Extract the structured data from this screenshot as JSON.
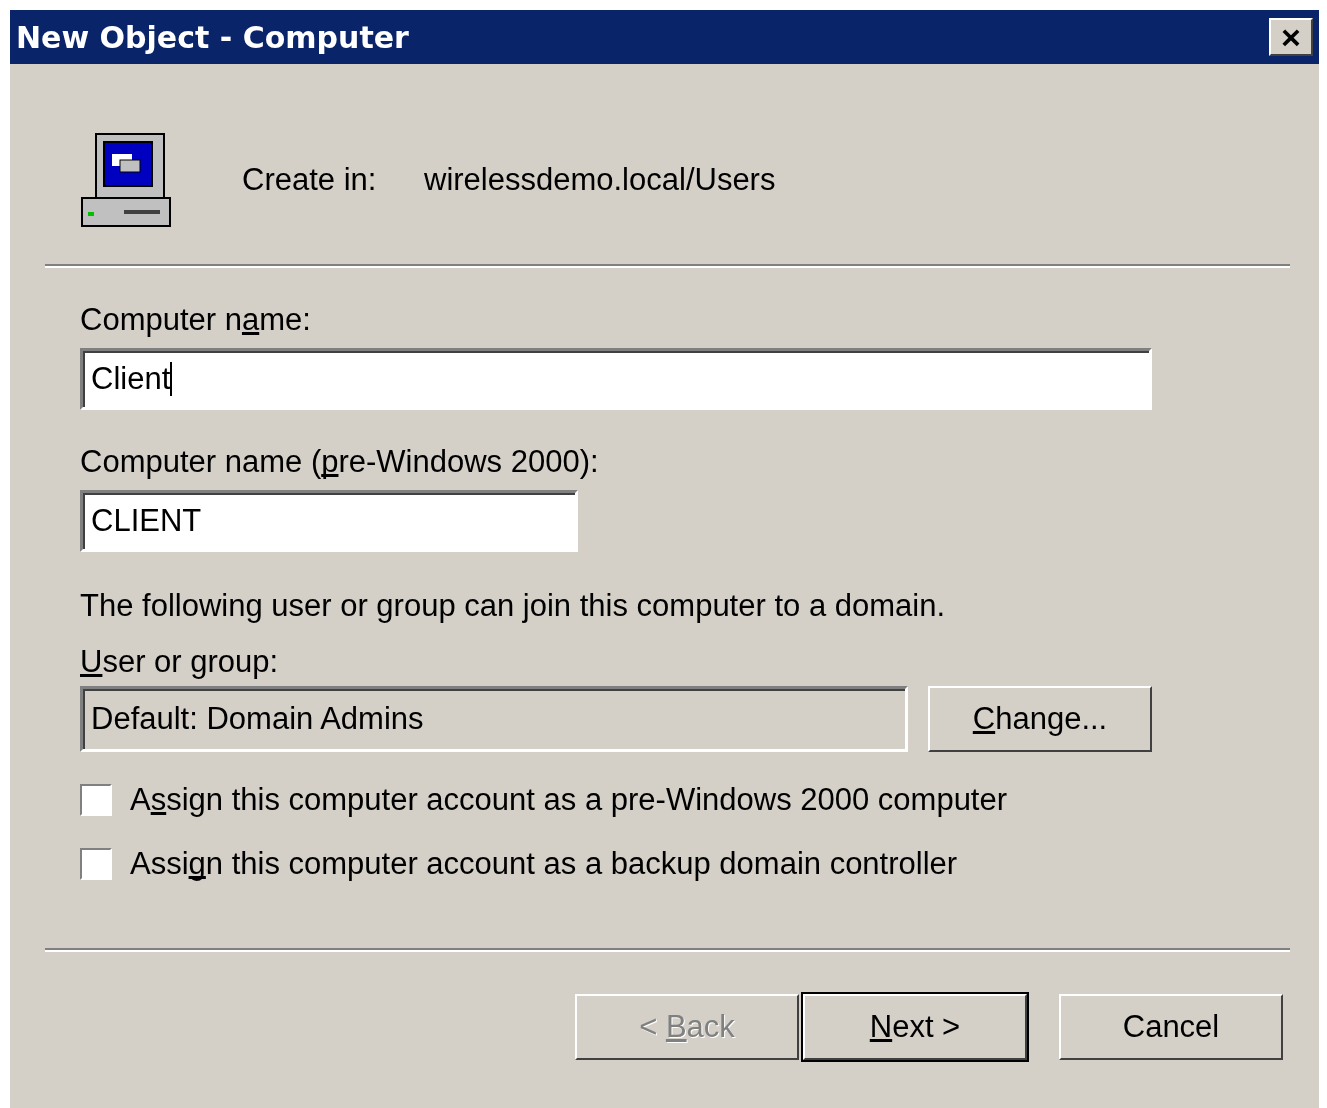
{
  "window": {
    "title": "New Object - Computer",
    "close": "×"
  },
  "header": {
    "label": "Create in:",
    "value": "wirelessdemo.local/Users"
  },
  "computer_name": {
    "label": {
      "before": "Computer n",
      "key": "a",
      "after": "me:"
    },
    "value": "Client"
  },
  "pre2000_name": {
    "label": {
      "before": "Computer name (",
      "key": "p",
      "after": "re-Windows 2000):"
    },
    "value": "CLIENT"
  },
  "join_note": "The following user or group can join this computer to a domain.",
  "user_group": {
    "label": {
      "key": "U",
      "after": "ser or group:"
    },
    "value": "Default: Domain Admins",
    "disabled": true,
    "button": {
      "label": {
        "key": "C",
        "after": "hange..."
      }
    }
  },
  "options": [
    {
      "label": {
        "before": "A",
        "key": "s",
        "after": "sign this computer account as a pre-Windows 2000 computer"
      },
      "checked": false
    },
    {
      "label": {
        "before": "Assi",
        "key": "g",
        "after": "n this computer account as a backup domain controller"
      },
      "checked": false
    }
  ],
  "buttons": [
    {
      "label": {
        "before": "< ",
        "key": "B",
        "after": "ack"
      },
      "disabled": true,
      "default": false
    },
    {
      "label": {
        "key": "N",
        "after": "ext >"
      },
      "disabled": false,
      "default": true
    },
    {
      "label": "Cancel",
      "disabled": false,
      "default": false
    }
  ]
}
